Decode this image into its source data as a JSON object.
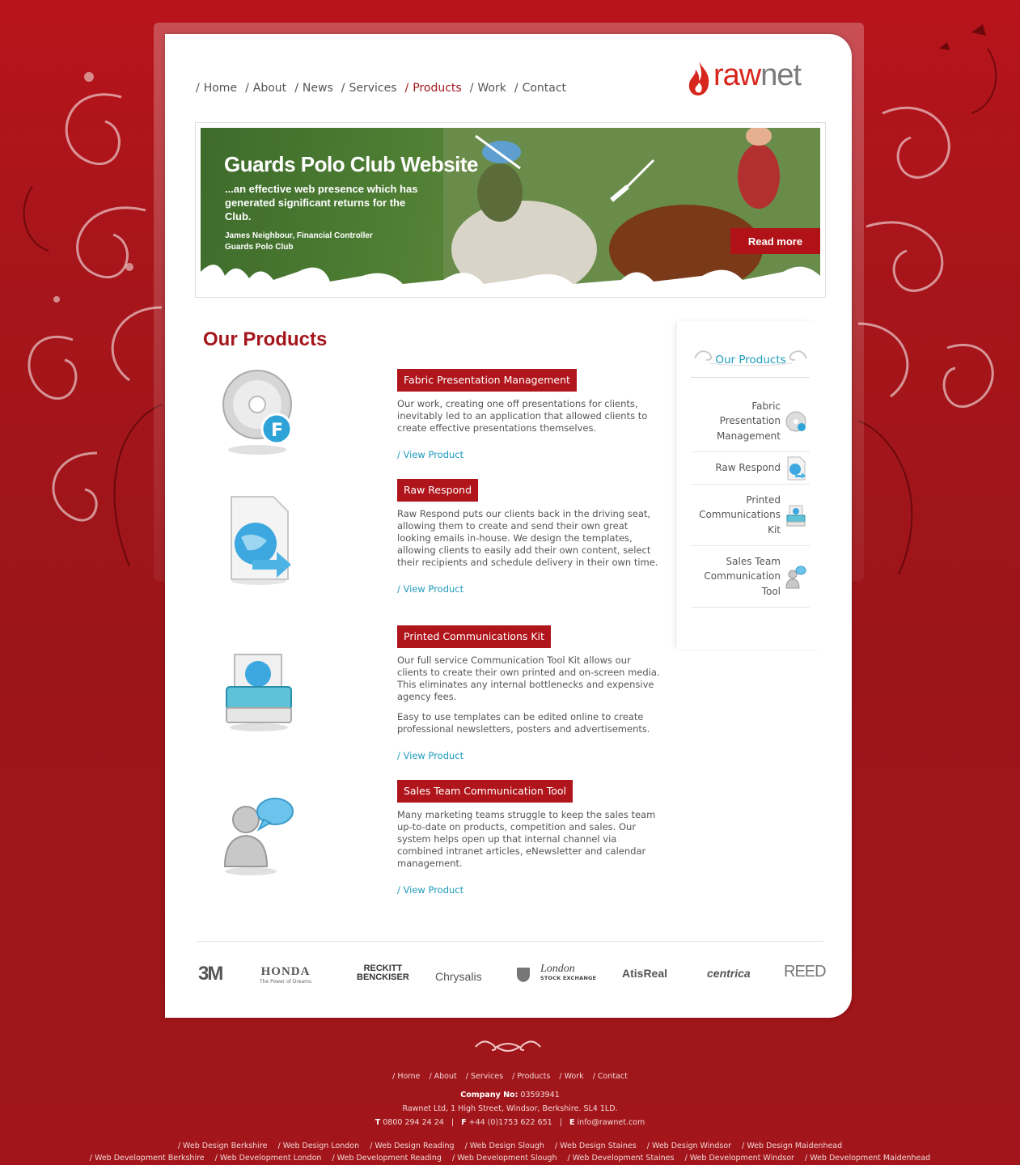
{
  "nav": {
    "items": [
      {
        "label": "Home"
      },
      {
        "label": "About"
      },
      {
        "label": "News"
      },
      {
        "label": "Services"
      },
      {
        "label": "Products",
        "active": true
      },
      {
        "label": "Work"
      },
      {
        "label": "Contact"
      }
    ],
    "separator": "/"
  },
  "logo": {
    "part1": "raw",
    "part2": "net"
  },
  "banner": {
    "title": "Guards Polo Club Website",
    "quote": "...an effective web presence which has generated significant returns for the Club.",
    "attribution_name": "James Neighbour, Financial Controller",
    "attribution_org": "Guards Polo Club",
    "read_more": "Read more"
  },
  "main": {
    "title": "Our Products",
    "view_label": "/ View Product",
    "products": [
      {
        "title": "Fabric Presentation Management",
        "paragraphs": [
          "Our work, creating one off presentations for clients, inevitably led to an application that allowed clients to create effective presentations themselves."
        ],
        "icon": "disc-f-icon"
      },
      {
        "title": "Raw Respond",
        "paragraphs": [
          "Raw Respond puts our clients back in the driving seat, allowing them to create and send their own great looking emails in-house. We design the templates, allowing clients to easily add their own content, select their recipients and schedule delivery in their own time."
        ],
        "icon": "globe-document-icon"
      },
      {
        "title": "Printed Communications Kit",
        "paragraphs": [
          "Our full service Communication Tool Kit allows our clients to create their own printed and on-screen media. This eliminates any internal bottlenecks and expensive agency fees.",
          "Easy to use templates can be edited online to create professional newsletters, posters and advertisements."
        ],
        "icon": "printer-icon"
      },
      {
        "title": "Sales Team Communication Tool",
        "paragraphs": [
          "Many marketing teams struggle to keep the sales team up-to-date on products, competition and sales. Our system helps open up that internal channel via combined intranet articles, eNewsletter and calendar management."
        ],
        "icon": "user-chat-icon"
      }
    ]
  },
  "sidebar": {
    "title": "Our Products",
    "items": [
      {
        "lines": [
          "Fabric",
          "Presentation",
          "Management"
        ]
      },
      {
        "lines": [
          "Raw Respond"
        ]
      },
      {
        "lines": [
          "Printed",
          "Communications",
          "Kit"
        ]
      },
      {
        "lines": [
          "Sales Team",
          "Communication",
          "Tool"
        ]
      }
    ]
  },
  "clients": [
    "3M",
    "HONDA",
    "The Power of Dreams",
    "RECKITT",
    "BENCKISER",
    "Chrysalis",
    "London",
    "STOCK EXCHANGE",
    "AtisReal",
    "centrica",
    "REED"
  ],
  "footer": {
    "nav": [
      "/ Home",
      "/ About",
      "/ Services",
      "/ Products",
      "/ Work",
      "/ Contact"
    ],
    "company_label": "Company No:",
    "company_no": "03593941",
    "address": "Rawnet Ltd, 1 High Street, Windsor, Berkshire. SL4 1LD.",
    "tel_label": "T",
    "tel": "0800 294 24 24",
    "fax_label": "F",
    "fax": "+44 (0)1753 622 651",
    "email_label": "E",
    "email": "info@rawnet.com",
    "sep": "|",
    "seo_row1": [
      "/ Web Design Berkshire",
      "/ Web Design London",
      "/ Web Design Reading",
      "/ Web Design Slough",
      "/ Web Design Staines",
      "/ Web Design Windsor",
      "/ Web Design Maidenhead"
    ],
    "seo_row2": [
      "/ Web Development Berkshire",
      "/ Web Development London",
      "/ Web Development Reading",
      "/ Web Development Slough",
      "/ Web Development Staines",
      "/ Web Development Windsor",
      "/ Web Development Maidenhead"
    ]
  },
  "colors": {
    "brand_red": "#a4161c",
    "accent_teal": "#1e9bbd",
    "background": "#a3161c"
  }
}
